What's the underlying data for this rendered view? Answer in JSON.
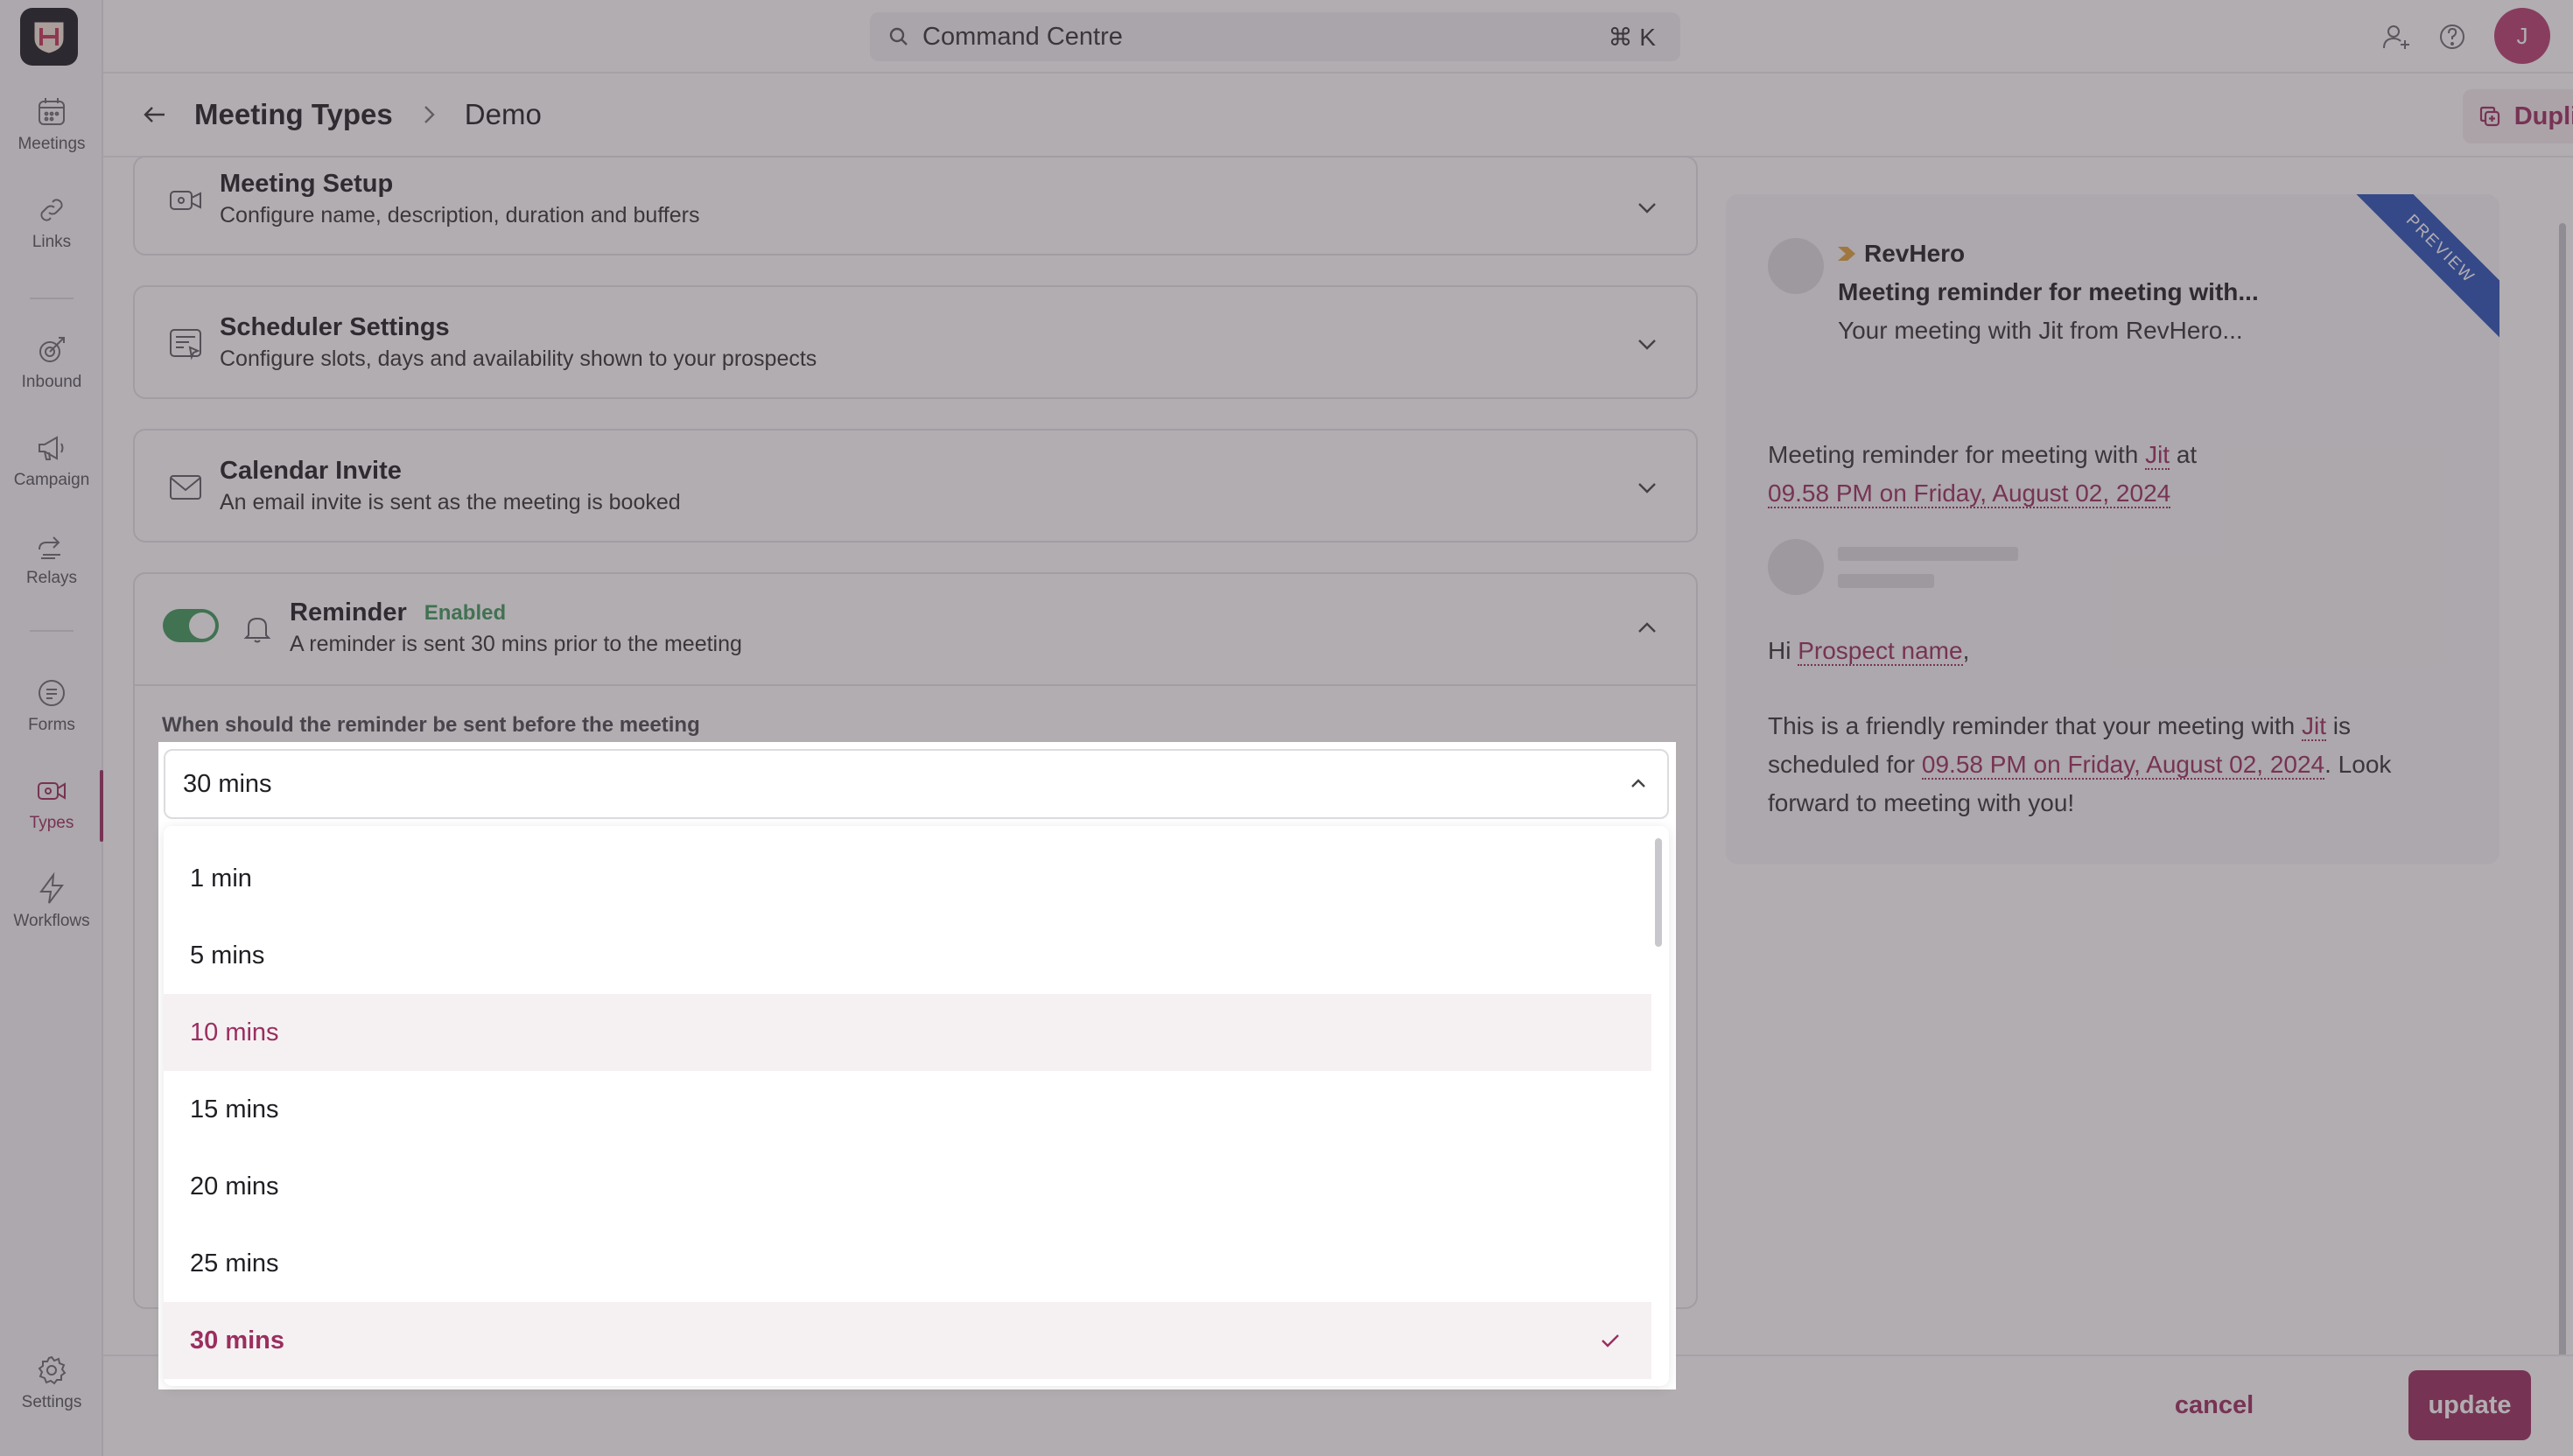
{
  "topbar": {
    "search_label": "Command Centre",
    "search_shortcut": "⌘ K",
    "avatar_initial": "J"
  },
  "sidebar": {
    "items": [
      {
        "label": "Meetings",
        "icon": "calendar-icon"
      },
      {
        "label": "Links",
        "icon": "link-icon"
      },
      {
        "label": "Inbound",
        "icon": "inbound-icon"
      },
      {
        "label": "Campaign",
        "icon": "megaphone-icon"
      },
      {
        "label": "Relays",
        "icon": "relay-icon"
      },
      {
        "label": "Forms",
        "icon": "form-icon"
      },
      {
        "label": "Types",
        "icon": "video-icon"
      },
      {
        "label": "Workflows",
        "icon": "lightning-icon"
      },
      {
        "label": "Settings",
        "icon": "gear-icon"
      }
    ],
    "active": "Types"
  },
  "breadcrumb": {
    "parent": "Meeting Types",
    "current": "Demo"
  },
  "duplicate_label": "Duplicate",
  "sections": {
    "setup": {
      "title": "Meeting Setup",
      "desc": "Configure name, description, duration and buffers"
    },
    "scheduler": {
      "title": "Scheduler Settings",
      "desc": "Configure slots, days and availability shown to your prospects"
    },
    "invite": {
      "title": "Calendar Invite",
      "desc": "An email invite is sent as the meeting is booked"
    },
    "reminder": {
      "title": "Reminder",
      "badge": "Enabled",
      "desc": "A reminder is sent 30 mins prior to the meeting",
      "field_label": "When should the reminder be sent before the meeting"
    }
  },
  "dropdown": {
    "selected": "30 mins",
    "options": [
      "1 min",
      "5 mins",
      "10 mins",
      "15 mins",
      "20 mins",
      "25 mins",
      "30 mins"
    ],
    "hovered": "10 mins"
  },
  "preview": {
    "ribbon": "PREVIEW",
    "sender": "RevHero",
    "subject": "Meeting reminder for meeting with...",
    "snippet": "Your meeting with Jit from RevHero...",
    "body_line1_pre": "Meeting reminder for meeting with ",
    "host": "Jit",
    "body_line1_post": " at",
    "datetime": "09.58 PM on Friday, August 02, 2024",
    "greeting": "Hi ",
    "prospect": "Prospect name",
    "greeting_end": ",",
    "para_pre": "This is a friendly reminder that your meeting with ",
    "para_mid": " is scheduled for ",
    "para_post": ". Look forward to meeting with you!"
  },
  "footer": {
    "cancel": "cancel",
    "update": "update"
  }
}
